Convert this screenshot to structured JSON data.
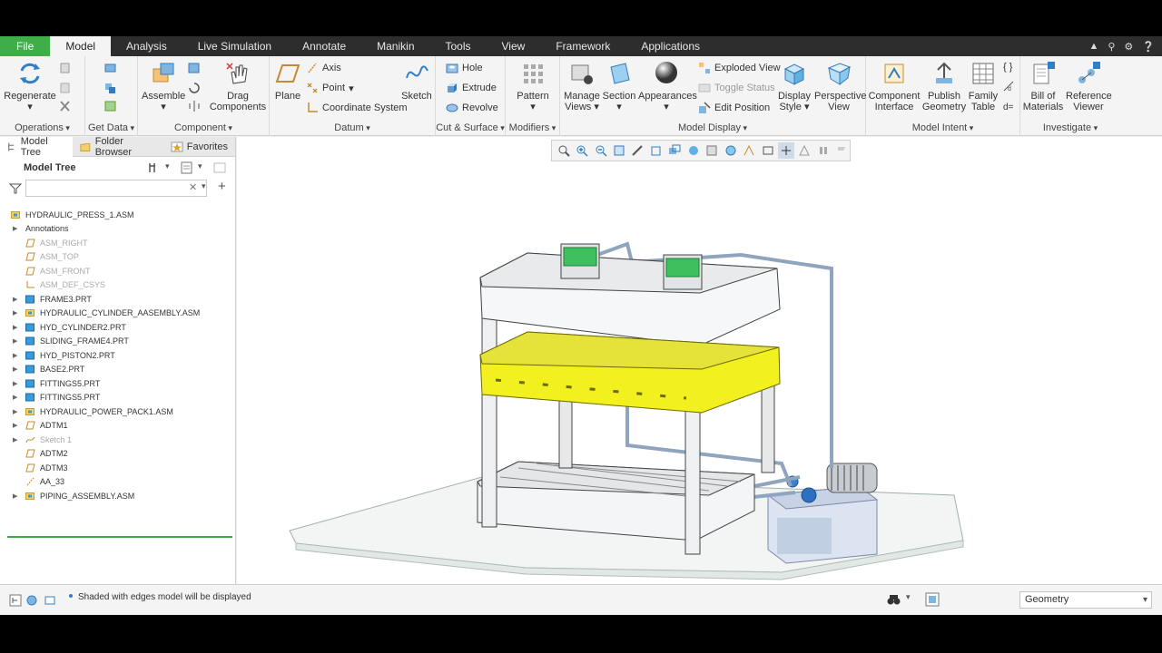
{
  "tabs": [
    "File",
    "Model",
    "Analysis",
    "Live Simulation",
    "Annotate",
    "Manikin",
    "Tools",
    "View",
    "Framework",
    "Applications"
  ],
  "active_tab": "Model",
  "ribbon": {
    "operations": {
      "label": "Operations",
      "regenerate": "Regenerate"
    },
    "get_data": {
      "label": "Get Data"
    },
    "component": {
      "label": "Component",
      "assemble": "Assemble",
      "drag": "Drag Components"
    },
    "datum": {
      "label": "Datum",
      "plane": "Plane",
      "axis": "Axis",
      "point": "Point",
      "csys": "Coordinate System",
      "sketch": "Sketch"
    },
    "cut_surface": {
      "label": "Cut & Surface",
      "hole": "Hole",
      "extrude": "Extrude",
      "revolve": "Revolve"
    },
    "modifiers": {
      "label": "Modifiers",
      "pattern": "Pattern"
    },
    "model_display": {
      "label": "Model Display",
      "manage_views": "Manage Views",
      "section": "Section",
      "appearances": "Appearances",
      "exploded_view": "Exploded View",
      "toggle_status": "Toggle Status",
      "edit_position": "Edit Position",
      "display_style": "Display Style",
      "perspective_view": "Perspective View"
    },
    "model_intent": {
      "label": "Model Intent",
      "component_interface": "Component Interface",
      "publish_geometry": "Publish Geometry",
      "family_table": "Family Table"
    },
    "investigate": {
      "label": "Investigate",
      "bom": "Bill of Materials",
      "reference_viewer": "Reference Viewer"
    }
  },
  "nav_tabs": [
    "Model Tree",
    "Folder Browser",
    "Favorites"
  ],
  "tree_title": "Model Tree",
  "filter_placeholder": "",
  "tree": [
    {
      "label": "HYDRAULIC_PRESS_1.ASM",
      "indent": 0,
      "icon": "assembly-icon",
      "expand": false,
      "dim": false
    },
    {
      "label": "Annotations",
      "indent": 1,
      "icon": "none",
      "expand": true,
      "dim": false
    },
    {
      "label": "ASM_RIGHT",
      "indent": 1,
      "icon": "datum-plane-icon",
      "expand": false,
      "dim": true
    },
    {
      "label": "ASM_TOP",
      "indent": 1,
      "icon": "datum-plane-icon",
      "expand": false,
      "dim": true
    },
    {
      "label": "ASM_FRONT",
      "indent": 1,
      "icon": "datum-plane-icon",
      "expand": false,
      "dim": true
    },
    {
      "label": "ASM_DEF_CSYS",
      "indent": 1,
      "icon": "csys-icon",
      "expand": false,
      "dim": true
    },
    {
      "label": "FRAME3.PRT",
      "indent": 1,
      "icon": "part-icon",
      "expand": true,
      "dim": false
    },
    {
      "label": "HYDRAULIC_CYLINDER_AASEMBLY.ASM",
      "indent": 1,
      "icon": "assembly-icon",
      "expand": true,
      "dim": false
    },
    {
      "label": "HYD_CYLINDER2.PRT",
      "indent": 1,
      "icon": "part-icon",
      "expand": true,
      "dim": false
    },
    {
      "label": "SLIDING_FRAME4.PRT",
      "indent": 1,
      "icon": "part-icon",
      "expand": true,
      "dim": false
    },
    {
      "label": "HYD_PISTON2.PRT",
      "indent": 1,
      "icon": "part-icon",
      "expand": true,
      "dim": false
    },
    {
      "label": "BASE2.PRT",
      "indent": 1,
      "icon": "part-icon",
      "expand": true,
      "dim": false
    },
    {
      "label": "FITTINGS5.PRT",
      "indent": 1,
      "icon": "part-icon",
      "expand": true,
      "dim": false
    },
    {
      "label": "FITTINGS5.PRT",
      "indent": 1,
      "icon": "part-icon",
      "expand": true,
      "dim": false
    },
    {
      "label": "HYDRAULIC_POWER_PACK1.ASM",
      "indent": 1,
      "icon": "assembly-icon",
      "expand": true,
      "dim": false
    },
    {
      "label": "ADTM1",
      "indent": 1,
      "icon": "datum-plane-icon",
      "expand": true,
      "dim": false
    },
    {
      "label": "Sketch 1",
      "indent": 1,
      "icon": "sketch-icon",
      "expand": true,
      "dim": true
    },
    {
      "label": "ADTM2",
      "indent": 1,
      "icon": "datum-plane-icon",
      "expand": false,
      "dim": false
    },
    {
      "label": "ADTM3",
      "indent": 1,
      "icon": "datum-plane-icon",
      "expand": false,
      "dim": false
    },
    {
      "label": "AA_33",
      "indent": 1,
      "icon": "axis-icon",
      "expand": false,
      "dim": false
    },
    {
      "label": "PIPING_ASSEMBLY.ASM",
      "indent": 1,
      "icon": "assembly-icon",
      "expand": true,
      "dim": false
    }
  ],
  "status_message": "Shaded with edges model will be displayed",
  "filter_select": "Geometry",
  "colors": {
    "accent": "#3fae49",
    "highlight": "#f2f01e",
    "tabbar": "#2d2d2d",
    "part_icon": "#3b9ad9"
  }
}
